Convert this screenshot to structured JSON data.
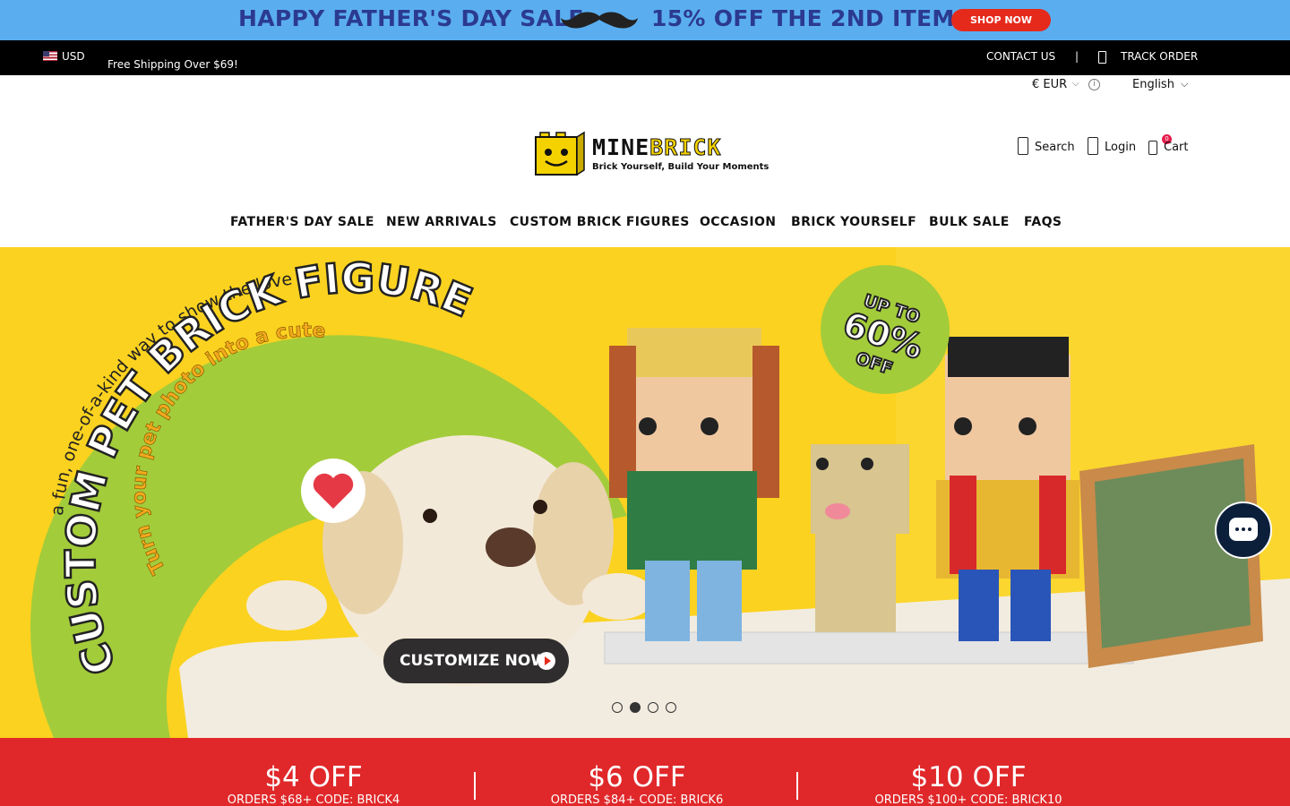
{
  "promo": {
    "left_text": "HAPPY FATHER'S DAY SALE",
    "right_text": "15% OFF THE 2ND ITEM",
    "shop_label": "SHOP NOW"
  },
  "topbar": {
    "currency": "USD",
    "free_shipping": "Free Shipping Over $69!",
    "contact": "CONTACT US",
    "separator": "|",
    "track": "TRACK ORDER"
  },
  "utility": {
    "currency": "€ EUR",
    "language": "English"
  },
  "logo": {
    "name_part1": "MINE",
    "name_part2": "BRICK",
    "tagline": "Brick Yourself, Build Your Moments"
  },
  "header_actions": {
    "search": "Search",
    "login": "Login",
    "cart": "Cart",
    "cart_count": "0"
  },
  "nav": [
    "FATHER'S DAY SALE",
    "NEW ARRIVALS",
    "CUSTOM BRICK FIGURES",
    "OCCASION",
    "BRICK YOURSELF",
    "BULK SALE",
    "FAQS"
  ],
  "hero": {
    "tagline": "a fun, one-of-a-kind way to show the love",
    "headline": "CUSTOM PET BRICK FIGURE",
    "subline": "Turn your pet photo into a cute",
    "badge_line1": "UP TO",
    "badge_line2": "60%",
    "badge_line3": "OFF",
    "cta": "CUSTOMIZE NOW",
    "slide_count": 4,
    "active_slide": 2
  },
  "coupons": [
    {
      "amount": "$4 OFF",
      "detail": "ORDERS $68+  CODE: BRICK4"
    },
    {
      "amount": "$6 OFF",
      "detail": "ORDERS $84+  CODE: BRICK6"
    },
    {
      "amount": "$10 OFF",
      "detail": "ORDERS $100+  CODE: BRICK10"
    }
  ],
  "colors": {
    "promo_bg": "#5aaef0",
    "promo_text": "#2b3a8f",
    "accent_red": "#e0282a",
    "hero_yellow": "#fbd21f",
    "hero_green": "#a3cc3a",
    "chat_bg": "#0c1f3a"
  }
}
